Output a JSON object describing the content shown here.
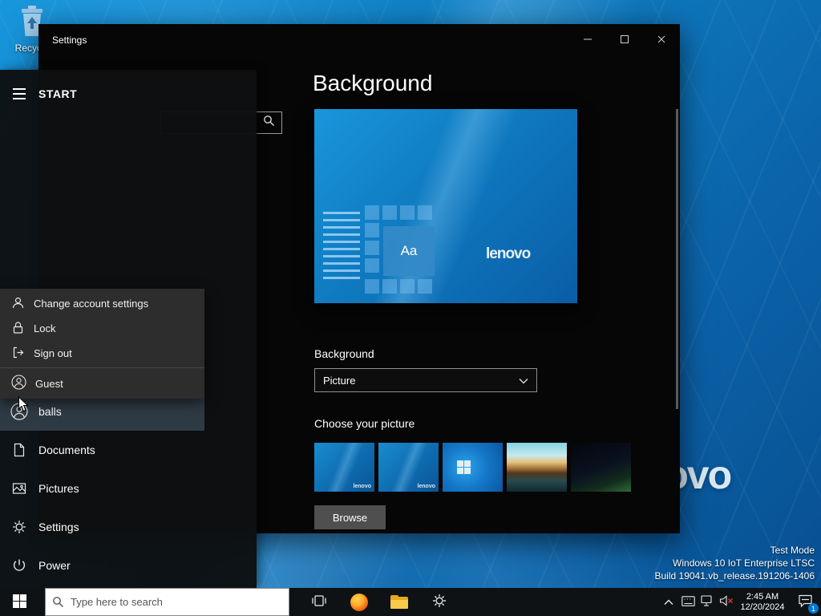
{
  "desktop": {
    "recycle_bin_label": "Recycle",
    "watermark": "lenovo",
    "test_mode_lines": [
      "Test Mode",
      "Windows 10 IoT Enterprise LTSC",
      "Build 19041.vb_release.191206-1406"
    ]
  },
  "settings_window": {
    "title": "Settings",
    "page_title": "Background",
    "preview": {
      "tile_label": "Aa",
      "watermark": "lenovo"
    },
    "background_section": {
      "label": "Background",
      "selected_option": "Picture"
    },
    "choose_picture_label": "Choose your picture",
    "browse_button_label": "Browse",
    "thumbnails": [
      {
        "name": "lenovo-wallpaper-1",
        "watermark": "lenovo"
      },
      {
        "name": "lenovo-wallpaper-2",
        "watermark": "lenovo"
      },
      {
        "name": "windows-default-wallpaper"
      },
      {
        "name": "beach-photo"
      },
      {
        "name": "night-sky-photo"
      }
    ]
  },
  "start_menu": {
    "header_label": "START",
    "user_flyout_items": [
      {
        "label": "Change account settings"
      },
      {
        "label": "Lock"
      },
      {
        "label": "Sign out"
      },
      {
        "label": "Guest"
      }
    ],
    "items": [
      {
        "label": "balls"
      },
      {
        "label": "Documents"
      },
      {
        "label": "Pictures"
      },
      {
        "label": "Settings"
      },
      {
        "label": "Power"
      }
    ]
  },
  "taskbar": {
    "search_placeholder": "Type here to search",
    "clock": {
      "time": "2:45 AM",
      "date": "12/20/2024"
    },
    "notification_badge": "1"
  }
}
